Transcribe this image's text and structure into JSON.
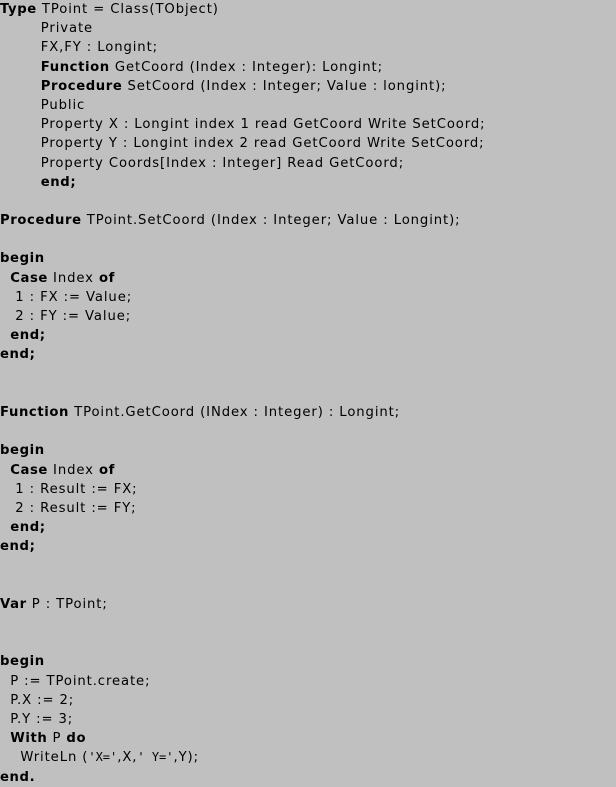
{
  "page": {
    "kind": "source-code-listing",
    "language": "Object Pascal",
    "background_color": "#c0c0c0",
    "text_color": "#000000"
  },
  "code": {
    "lines": [
      {
        "id": "l01",
        "indent": "",
        "keyword": "Type",
        "rest": " TPoint = Class(TObject)"
      },
      {
        "id": "l02",
        "indent": "        ",
        "keyword": "",
        "rest": "Private"
      },
      {
        "id": "l03",
        "indent": "        ",
        "keyword": "",
        "rest": "FX,FY : Longint;"
      },
      {
        "id": "l04",
        "indent": "        ",
        "keyword": "Function",
        "rest": " GetCoord (Index : Integer): Longint;"
      },
      {
        "id": "l05",
        "indent": "        ",
        "keyword": "Procedure",
        "rest": " SetCoord (Index : Integer; Value : longint);"
      },
      {
        "id": "l06",
        "indent": "        ",
        "keyword": "",
        "rest": "Public"
      },
      {
        "id": "l07",
        "indent": "        ",
        "keyword": "",
        "rest": "Property X : Longint index 1 read GetCoord Write SetCoord;"
      },
      {
        "id": "l08",
        "indent": "        ",
        "keyword": "",
        "rest": "Property Y : Longint index 2 read GetCoord Write SetCoord;"
      },
      {
        "id": "l09",
        "indent": "        ",
        "keyword": "",
        "rest": "Property Coords[Index : Integer] Read GetCoord;"
      },
      {
        "id": "l10",
        "indent": "        ",
        "keyword": "end;",
        "rest": ""
      },
      {
        "id": "l11",
        "indent": "",
        "keyword": "",
        "rest": "",
        "blank": true
      },
      {
        "id": "l12",
        "indent": "",
        "keyword": "Procedure",
        "rest": " TPoint.SetCoord (Index : Integer; Value : Longint);"
      },
      {
        "id": "l13",
        "indent": "",
        "keyword": "",
        "rest": "",
        "blank": true
      },
      {
        "id": "l14",
        "indent": "",
        "keyword": "begin",
        "rest": ""
      },
      {
        "id": "l15",
        "indent": "  ",
        "keyword": "Case",
        "rest": " Index ",
        "keyword2": "of"
      },
      {
        "id": "l16",
        "indent": "   ",
        "keyword": "",
        "rest": "1 : FX := Value;"
      },
      {
        "id": "l17",
        "indent": "   ",
        "keyword": "",
        "rest": "2 : FY := Value;"
      },
      {
        "id": "l18",
        "indent": "  ",
        "keyword": "end;",
        "rest": ""
      },
      {
        "id": "l19",
        "indent": "",
        "keyword": "end;",
        "rest": ""
      },
      {
        "id": "l20",
        "indent": "",
        "keyword": "",
        "rest": "",
        "blank": true
      },
      {
        "id": "l21",
        "indent": "",
        "keyword": "",
        "rest": "",
        "blank": true
      },
      {
        "id": "l22",
        "indent": "",
        "keyword": "Function",
        "rest": " TPoint.GetCoord (INdex : Integer) : Longint;"
      },
      {
        "id": "l23",
        "indent": "",
        "keyword": "",
        "rest": "",
        "blank": true
      },
      {
        "id": "l24",
        "indent": "",
        "keyword": "begin",
        "rest": ""
      },
      {
        "id": "l25",
        "indent": "  ",
        "keyword": "Case",
        "rest": " Index ",
        "keyword2": "of"
      },
      {
        "id": "l26",
        "indent": "   ",
        "keyword": "",
        "rest": "1 : Result := FX;"
      },
      {
        "id": "l27",
        "indent": "   ",
        "keyword": "",
        "rest": "2 : Result := FY;"
      },
      {
        "id": "l28",
        "indent": "  ",
        "keyword": "end;",
        "rest": ""
      },
      {
        "id": "l29",
        "indent": "",
        "keyword": "end;",
        "rest": ""
      },
      {
        "id": "l30",
        "indent": "",
        "keyword": "",
        "rest": "",
        "blank": true
      },
      {
        "id": "l31",
        "indent": "",
        "keyword": "",
        "rest": "",
        "blank": true
      },
      {
        "id": "l32",
        "indent": "",
        "keyword": "Var",
        "rest": " P : TPoint;"
      },
      {
        "id": "l33",
        "indent": "",
        "keyword": "",
        "rest": "",
        "blank": true
      },
      {
        "id": "l34",
        "indent": "",
        "keyword": "",
        "rest": "",
        "blank": true
      },
      {
        "id": "l35",
        "indent": "",
        "keyword": "begin",
        "rest": ""
      },
      {
        "id": "l36",
        "indent": "  ",
        "keyword": "",
        "rest": "P := TPoint.create;"
      },
      {
        "id": "l37",
        "indent": "  ",
        "keyword": "",
        "rest": "P.X := 2;"
      },
      {
        "id": "l38",
        "indent": "  ",
        "keyword": "",
        "rest": "P.Y := 3;"
      },
      {
        "id": "l39",
        "indent": "  ",
        "keyword": "With",
        "rest": " P ",
        "keyword2": "do"
      },
      {
        "id": "l40",
        "indent": "    ",
        "keyword": "",
        "rest": "WriteLn (",
        "string1": "'X='",
        "mid1": ",X,",
        "string2": "' Y='",
        "mid2": ",Y);"
      },
      {
        "id": "l41",
        "indent": "",
        "keyword": "end.",
        "rest": ""
      }
    ]
  }
}
